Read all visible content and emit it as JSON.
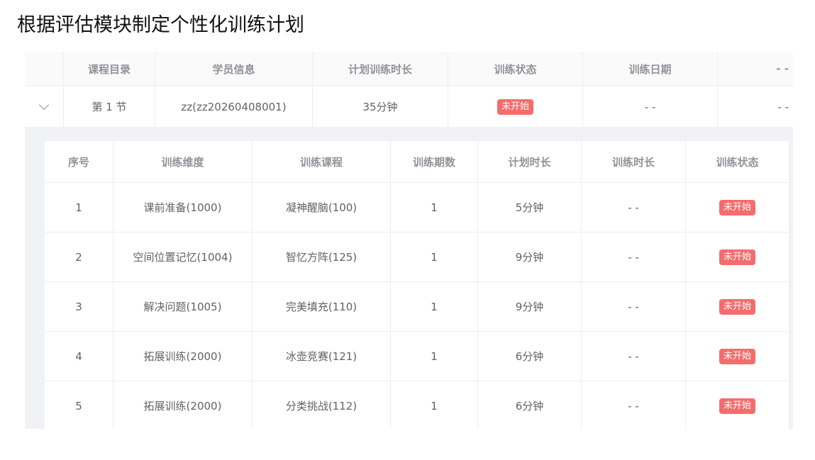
{
  "title": "根据评估模块制定个性化训练计划",
  "outer_table": {
    "headers": [
      "课程目录",
      "学员信息",
      "计划训练时长",
      "训练状态",
      "训练日期",
      "- -"
    ],
    "row": {
      "chapter": "第 1 节",
      "student": "zz(zz20260408001)",
      "planned_duration": "35分钟",
      "status": "未开始",
      "date": "- -",
      "extra": "- -"
    }
  },
  "inner_table": {
    "headers": [
      "序号",
      "训练维度",
      "训练课程",
      "训练期数",
      "计划时长",
      "训练时长",
      "训练状态"
    ],
    "rows": [
      {
        "no": "1",
        "dimension": "课前准备(1000)",
        "course": "凝神醒脑(100)",
        "periods": "1",
        "planned": "5分钟",
        "actual": "- -",
        "status": "未开始"
      },
      {
        "no": "2",
        "dimension": "空间位置记忆(1004)",
        "course": "智忆方阵(125)",
        "periods": "1",
        "planned": "9分钟",
        "actual": "- -",
        "status": "未开始"
      },
      {
        "no": "3",
        "dimension": "解决问题(1005)",
        "course": "完美填充(110)",
        "periods": "1",
        "planned": "9分钟",
        "actual": "- -",
        "status": "未开始"
      },
      {
        "no": "4",
        "dimension": "拓展训练(2000)",
        "course": "冰壶竞赛(121)",
        "periods": "1",
        "planned": "6分钟",
        "actual": "- -",
        "status": "未开始"
      },
      {
        "no": "5",
        "dimension": "拓展训练(2000)",
        "course": "分类挑战(112)",
        "periods": "1",
        "planned": "6分钟",
        "actual": "- -",
        "status": "未开始"
      }
    ]
  },
  "colors": {
    "status_tag": "#f56c6c",
    "header_text": "#909399",
    "cell_text": "#606266",
    "border": "#ebeef5",
    "panel_bg": "#f0f2f5"
  }
}
